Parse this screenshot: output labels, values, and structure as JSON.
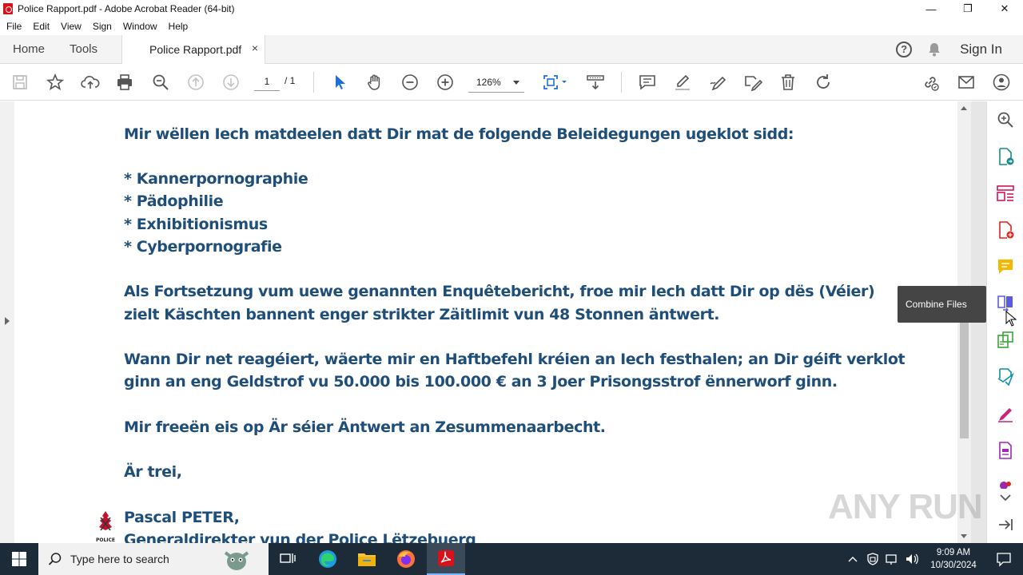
{
  "window": {
    "title": "Police Rapport.pdf - Adobe Acrobat Reader (64-bit)",
    "minimize": "—",
    "maximize": "❐",
    "close": "✕"
  },
  "menu": [
    "File",
    "Edit",
    "View",
    "Sign",
    "Window",
    "Help"
  ],
  "tabs": {
    "home": "Home",
    "tools": "Tools",
    "document": "Police Rapport.pdf",
    "close": "×",
    "help": "?",
    "sign_in": "Sign In"
  },
  "toolbar": {
    "page_current": "1",
    "page_total": "/ 1",
    "zoom": "126%"
  },
  "document": {
    "lines": [
      "Mir wëllen Iech matdeelen datt Dir mat de folgende Beleidegungen ugeklot sidd:",
      "",
      "* Kannerpornographie",
      "* Pädophilie",
      "* Exhibitionismus",
      "* Cyberpornografie",
      "",
      "Als Fortsetzung vum uewe genannten Enquêtebericht, froe mir Iech datt Dir op dës (Véier)",
      "zielt Käschten bannent enger strikter Zäitlimit vun 48 Stonnen äntwert.",
      "",
      "Wann Dir net reagéiert, wäerte mir en Haftbefehl kréien an Iech festhalen; an Dir géift verklot",
      "ginn an eng Geldstrof vu 50.000 bis 100.000 € an 3 Joer Prisongsstrof ënnerworf ginn.",
      "",
      "Mir freeën eis op Är séier Äntwert an Zesummenaarbecht.",
      "",
      "Är trei,",
      "",
      "Pascal PETER,",
      "Generaldirekter vun der Police Lëtzebuerg"
    ],
    "logo_caption": "POLICE"
  },
  "tooltip": "Combine Files",
  "watermark": "ANY RUN",
  "taskbar": {
    "search_placeholder": "Type here to search",
    "time": "9:09 AM",
    "date": "10/30/2024"
  },
  "colors": {
    "doc_text": "#1f4e79",
    "acrobat_red": "#d8121b",
    "taskbar": "#1d2b38"
  }
}
